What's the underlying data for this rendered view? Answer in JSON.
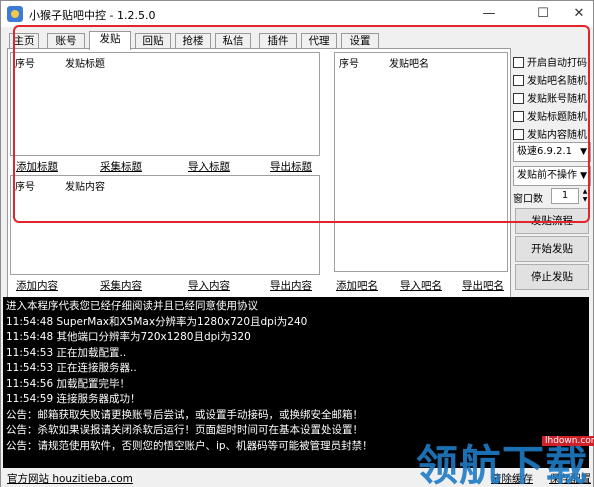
{
  "window": {
    "title": "小猴子贴吧中控 - 1.2.5.0",
    "min": "—",
    "max": "☐",
    "close": "✕"
  },
  "tabs": [
    "主页",
    "账号",
    "发贴",
    "回贴",
    "抢楼",
    "私信",
    "插件",
    "代理",
    "设置"
  ],
  "active_tab": "发贴",
  "title_list": {
    "col_index": "序号",
    "col_title": "发贴标题"
  },
  "title_actions": [
    "添加标题",
    "采集标题",
    "导入标题",
    "导出标题"
  ],
  "content_list": {
    "col_index": "序号",
    "col_content": "发贴内容"
  },
  "content_actions": [
    "添加内容",
    "采集内容",
    "导入内容",
    "导出内容"
  ],
  "bar_list": {
    "col_index": "序号",
    "col_name": "发贴吧名"
  },
  "bar_actions": [
    "添加吧名",
    "导入吧名",
    "导出吧名"
  ],
  "options": [
    "开启自动打码",
    "发贴吧名随机",
    "发贴账号随机",
    "发贴标题随机",
    "发贴内容随机"
  ],
  "speed_select": "极速6.9.2.1",
  "pre_action_select": "发贴前不操作",
  "window_count": {
    "label": "窗口数",
    "value": "1"
  },
  "buttons": {
    "flow": "发贴流程",
    "start": "开始发贴",
    "stop": "停止发贴"
  },
  "log_lines": [
    "进入本程序代表您已经仔细阅读并且已经同意使用协议",
    "11:54:48 SuperMax和X5Max分辨率为1280x720且dpi为240",
    "11:54:48 其他端口分辨率为720x1280且dpi为320",
    "11:54:53 正在加载配置..",
    "11:54:53 正在连接服务器..",
    "11:54:56 加载配置完毕！",
    "11:54:59 连接服务器成功！",
    "公告：邮箱获取失败请更换账号后尝试，或设置手动接码，或换绑安全邮箱！",
    "公告：杀软如果误报请关闭杀软后运行！页面超时时间可在基本设置处设置！",
    "公告：请规范使用软件，否则您的悟空账户、ip、机器码等可能被管理员封禁！"
  ],
  "status": {
    "site": "官方网站 houzitieba.com",
    "right": "清除缓存",
    "right2": "保存配置"
  },
  "watermark": {
    "text": "领航下载",
    "url": "lhdown.com"
  },
  "colors": {
    "highlight_border": "#e1252a",
    "console_bg": "#000000",
    "watermark": "#1f7bc4"
  }
}
